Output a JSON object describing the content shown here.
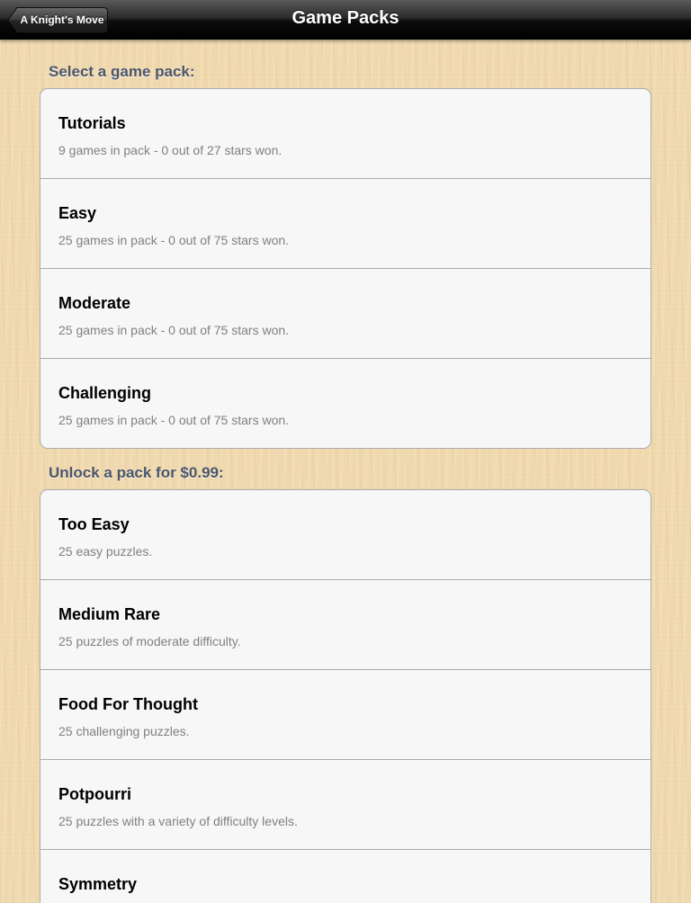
{
  "navbar": {
    "title": "Game Packs",
    "back_label": "A Knight's Move"
  },
  "owned_section": {
    "header": "Select a game pack:",
    "items": [
      {
        "title": "Tutorials",
        "subtitle": "9 games in pack - 0 out of 27 stars won."
      },
      {
        "title": "Easy",
        "subtitle": "25 games in pack - 0 out of 75 stars won."
      },
      {
        "title": "Moderate",
        "subtitle": "25 games in pack - 0 out of 75 stars won."
      },
      {
        "title": "Challenging",
        "subtitle": "25 games in pack - 0 out of 75 stars won."
      }
    ]
  },
  "store_section": {
    "header": "Unlock a pack for $0.99:",
    "items": [
      {
        "title": "Too Easy",
        "subtitle": "25 easy puzzles."
      },
      {
        "title": "Medium Rare",
        "subtitle": "25 puzzles of moderate difficulty."
      },
      {
        "title": "Food For Thought",
        "subtitle": "25 challenging puzzles."
      },
      {
        "title": "Potpourri",
        "subtitle": "25 puzzles with a variety of difficulty levels."
      },
      {
        "title": "Symmetry",
        "subtitle": ""
      }
    ]
  }
}
